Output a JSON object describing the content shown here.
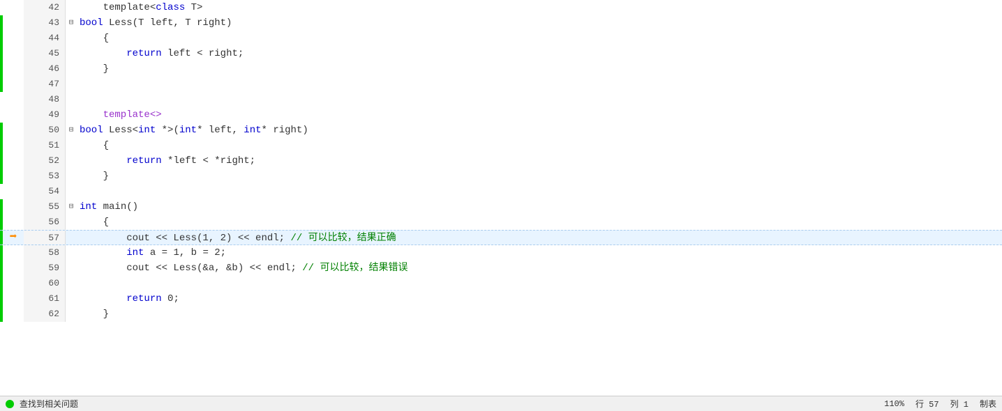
{
  "editor": {
    "lines": [
      {
        "num": 42,
        "fold": "",
        "gutter": "",
        "indent": 0,
        "tokens": [
          {
            "t": "plain",
            "v": "    template"
          },
          {
            "t": "plain",
            "v": "<"
          },
          {
            "t": "kw2",
            "v": "class"
          },
          {
            "t": "plain",
            "v": " T>"
          }
        ],
        "highlight": false,
        "greenbar": false
      },
      {
        "num": 43,
        "fold": "⊟",
        "gutter": "",
        "indent": 0,
        "tokens": [
          {
            "t": "kw2",
            "v": "bool"
          },
          {
            "t": "plain",
            "v": " Less(T left, T right)"
          }
        ],
        "highlight": false,
        "greenbar": true
      },
      {
        "num": 44,
        "fold": "",
        "gutter": "",
        "indent": 4,
        "tokens": [
          {
            "t": "plain",
            "v": "    {"
          }
        ],
        "highlight": false,
        "greenbar": true
      },
      {
        "num": 45,
        "fold": "",
        "gutter": "",
        "indent": 8,
        "tokens": [
          {
            "t": "plain",
            "v": "        "
          },
          {
            "t": "kw2",
            "v": "return"
          },
          {
            "t": "plain",
            "v": " left "
          },
          {
            "t": "plain",
            "v": "< right;"
          }
        ],
        "highlight": false,
        "greenbar": true
      },
      {
        "num": 46,
        "fold": "",
        "gutter": "",
        "indent": 4,
        "tokens": [
          {
            "t": "plain",
            "v": "    }"
          }
        ],
        "highlight": false,
        "greenbar": true
      },
      {
        "num": 47,
        "fold": "",
        "gutter": "",
        "indent": 0,
        "tokens": [],
        "highlight": false,
        "greenbar": true
      },
      {
        "num": 48,
        "fold": "",
        "gutter": "",
        "indent": 0,
        "tokens": [],
        "highlight": false,
        "greenbar": false
      },
      {
        "num": 49,
        "fold": "",
        "gutter": "",
        "indent": 4,
        "tokens": [
          {
            "t": "tpl",
            "v": "    template<>"
          }
        ],
        "highlight": false,
        "greenbar": false
      },
      {
        "num": 50,
        "fold": "⊟",
        "gutter": "",
        "indent": 0,
        "tokens": [
          {
            "t": "kw2",
            "v": "bool"
          },
          {
            "t": "plain",
            "v": " Less"
          },
          {
            "t": "plain",
            "v": "<"
          },
          {
            "t": "kw2",
            "v": "int"
          },
          {
            "t": "plain",
            "v": " *>("
          },
          {
            "t": "kw2",
            "v": "int"
          },
          {
            "t": "plain",
            "v": "* left, "
          },
          {
            "t": "kw2",
            "v": "int"
          },
          {
            "t": "plain",
            "v": "* right)"
          }
        ],
        "highlight": false,
        "greenbar": true
      },
      {
        "num": 51,
        "fold": "",
        "gutter": "",
        "indent": 4,
        "tokens": [
          {
            "t": "plain",
            "v": "    {"
          }
        ],
        "highlight": false,
        "greenbar": true
      },
      {
        "num": 52,
        "fold": "",
        "gutter": "",
        "indent": 8,
        "tokens": [
          {
            "t": "plain",
            "v": "        "
          },
          {
            "t": "kw2",
            "v": "return"
          },
          {
            "t": "plain",
            "v": " *left "
          },
          {
            "t": "plain",
            "v": "< *right;"
          }
        ],
        "highlight": false,
        "greenbar": true
      },
      {
        "num": 53,
        "fold": "",
        "gutter": "",
        "indent": 4,
        "tokens": [
          {
            "t": "plain",
            "v": "    }"
          }
        ],
        "highlight": false,
        "greenbar": true
      },
      {
        "num": 54,
        "fold": "",
        "gutter": "",
        "indent": 0,
        "tokens": [],
        "highlight": false,
        "greenbar": false
      },
      {
        "num": 55,
        "fold": "⊟",
        "gutter": "",
        "indent": 0,
        "tokens": [
          {
            "t": "kw2",
            "v": "int"
          },
          {
            "t": "plain",
            "v": " main()"
          }
        ],
        "highlight": false,
        "greenbar": true
      },
      {
        "num": 56,
        "fold": "",
        "gutter": "",
        "indent": 4,
        "tokens": [
          {
            "t": "plain",
            "v": "    {"
          }
        ],
        "highlight": false,
        "greenbar": true
      },
      {
        "num": 57,
        "fold": "",
        "gutter": "arrow",
        "indent": 8,
        "tokens": [
          {
            "t": "plain",
            "v": "        cout "
          },
          {
            "t": "plain",
            "v": "<< Less(1, 2) << endl; "
          },
          {
            "t": "cmt",
            "v": "// 可以比较，结果正确"
          }
        ],
        "highlight": true,
        "greenbar": true
      },
      {
        "num": 58,
        "fold": "",
        "gutter": "",
        "indent": 8,
        "tokens": [
          {
            "t": "plain",
            "v": "        "
          },
          {
            "t": "kw2",
            "v": "int"
          },
          {
            "t": "plain",
            "v": " a = 1, b = 2;"
          }
        ],
        "highlight": false,
        "greenbar": true
      },
      {
        "num": 59,
        "fold": "",
        "gutter": "",
        "indent": 8,
        "tokens": [
          {
            "t": "plain",
            "v": "        cout "
          },
          {
            "t": "plain",
            "v": "<< Less(&a, &b) << endl; "
          },
          {
            "t": "cmt",
            "v": "// 可以比较，结果错误"
          }
        ],
        "highlight": false,
        "greenbar": true
      },
      {
        "num": 60,
        "fold": "",
        "gutter": "",
        "indent": 0,
        "tokens": [],
        "highlight": false,
        "greenbar": true
      },
      {
        "num": 61,
        "fold": "",
        "gutter": "",
        "indent": 8,
        "tokens": [
          {
            "t": "plain",
            "v": "        "
          },
          {
            "t": "kw2",
            "v": "return"
          },
          {
            "t": "plain",
            "v": " 0;"
          }
        ],
        "highlight": false,
        "greenbar": true
      },
      {
        "num": 62,
        "fold": "",
        "gutter": "",
        "indent": 4,
        "tokens": [
          {
            "t": "plain",
            "v": "    }"
          }
        ],
        "highlight": false,
        "greenbar": true
      }
    ],
    "zoom": "110%",
    "status_left": "查找到相关问题",
    "status_right_row": "行 57",
    "status_right_col": "列 1",
    "status_right_encoding": "制表"
  }
}
